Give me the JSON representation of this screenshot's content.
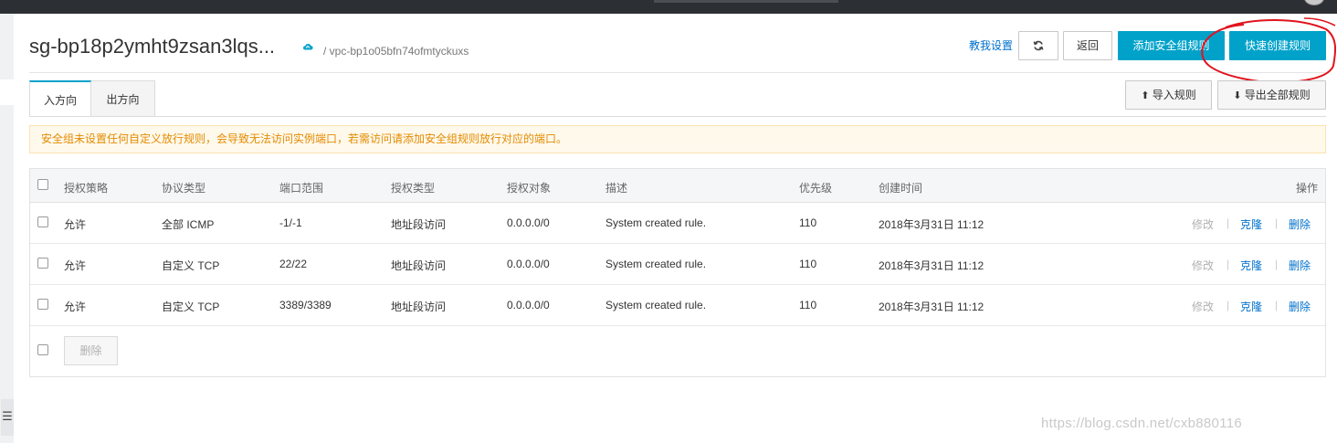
{
  "header": {
    "title": "sg-bp18p2ymht9zsan3lqs...",
    "subtitle": "/ vpc-bp1o05bfn74ofmtyckuxs",
    "setup_link": "教我设置",
    "back_label": "返回",
    "add_rule_label": "添加安全组规则",
    "quick_create_label": "快速创建规则"
  },
  "tabs": [
    {
      "label": "入方向",
      "active": true
    },
    {
      "label": "出方向",
      "active": false
    }
  ],
  "toolbar": {
    "import_label": "导入规则",
    "export_label": "导出全部规则"
  },
  "warning": "安全组未设置任何自定义放行规则，会导致无法访问实例端口，若需访问请添加安全组规则放行对应的端口。",
  "table": {
    "columns": [
      "授权策略",
      "协议类型",
      "端口范围",
      "授权类型",
      "授权对象",
      "描述",
      "优先级",
      "创建时间",
      "操作"
    ],
    "rows": [
      {
        "policy": "允许",
        "protocol": "全部 ICMP",
        "port": "-1/-1",
        "auth_type": "地址段访问",
        "auth_object": "0.0.0.0/0",
        "desc": "System created rule.",
        "priority": "110",
        "created": "2018年3月31日 11:12"
      },
      {
        "policy": "允许",
        "protocol": "自定义 TCP",
        "port": "22/22",
        "auth_type": "地址段访问",
        "auth_object": "0.0.0.0/0",
        "desc": "System created rule.",
        "priority": "110",
        "created": "2018年3月31日 11:12"
      },
      {
        "policy": "允许",
        "protocol": "自定义 TCP",
        "port": "3389/3389",
        "auth_type": "地址段访问",
        "auth_object": "0.0.0.0/0",
        "desc": "System created rule.",
        "priority": "110",
        "created": "2018年3月31日 11:12"
      }
    ],
    "row_actions": {
      "edit": "修改",
      "clone": "克隆",
      "delete": "删除"
    },
    "batch_delete_label": "删除"
  },
  "watermark": "https://blog.csdn.net/cxb880116",
  "colors": {
    "primary": "#00a2ca",
    "link": "#0070cc",
    "warning_text": "#e38b00",
    "annotation": "#e0141e"
  },
  "icons": {
    "refresh": "refresh-icon",
    "cloud": "cloud-icon",
    "upload": "upload-icon",
    "download": "download-icon",
    "menu": "menu-icon"
  }
}
